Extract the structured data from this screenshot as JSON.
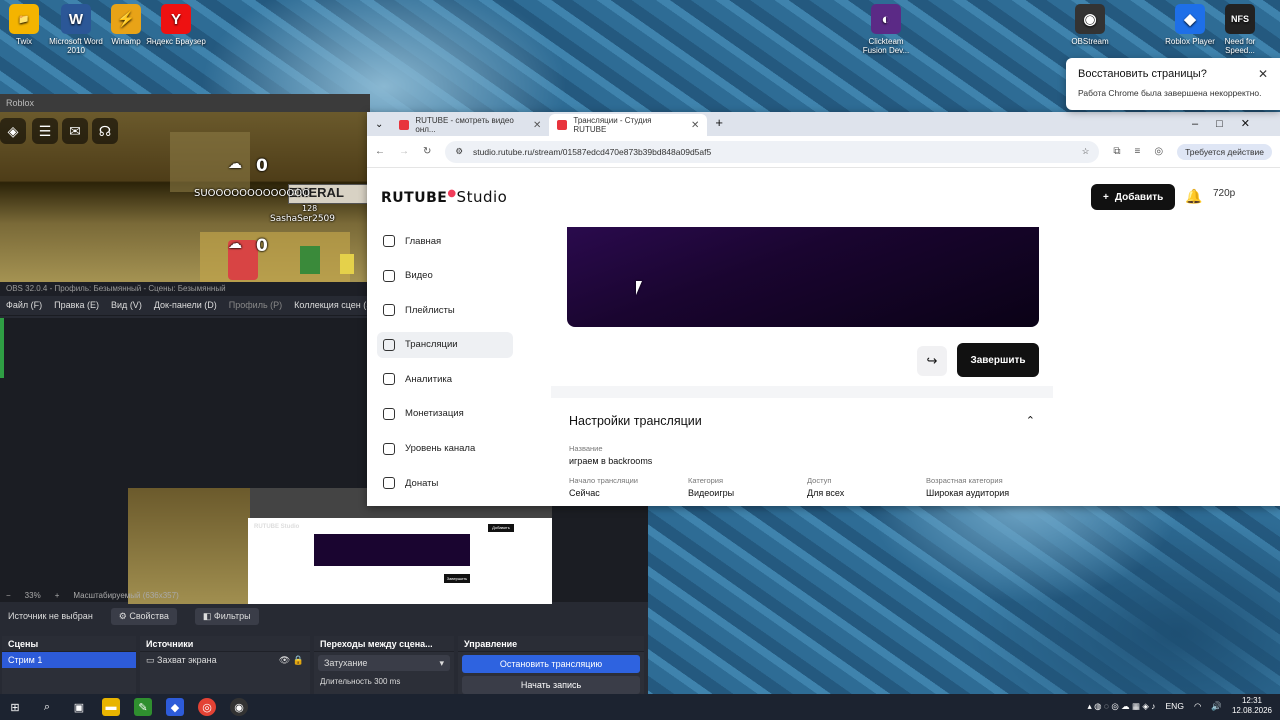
{
  "desktop": {
    "icons_left": [
      {
        "label": "Twix",
        "name": "twix-desktop-icon",
        "color": "#f4b400",
        "glyph": "📁"
      },
      {
        "label": "Microsoft Word 2010",
        "name": "word-desktop-icon",
        "color": "#2b5797",
        "glyph": "W"
      },
      {
        "label": "Winamp",
        "name": "winamp-desktop-icon",
        "color": "#e8a317",
        "glyph": "⚡"
      },
      {
        "label": "Яндекс Браузер",
        "name": "yandex-browser-desktop-icon",
        "color": "#e11",
        "glyph": "Y"
      }
    ],
    "icons_right": [
      {
        "label": "Clickteam Fusion Dev...",
        "name": "clickteam-desktop-icon",
        "color": "#5b2a86",
        "glyph": "◐"
      },
      {
        "label": "OBStream",
        "name": "obs-desktop-icon",
        "color": "#333",
        "glyph": "◉"
      },
      {
        "label": "Roblox Player",
        "name": "roblox-desktop-icon",
        "color": "#1e6fe8",
        "glyph": "◆"
      },
      {
        "label": "Need for Speed...",
        "name": "nfs-desktop-icon",
        "color": "#222",
        "glyph": "NFS"
      }
    ]
  },
  "game": {
    "title": "Roblox",
    "score_top": "0",
    "score_bottom": "0",
    "chat_line": "SUOOOOOOOOOOOOO",
    "player_name": "SashaSer2509",
    "player_level": "128",
    "sign_text": "EMERAL"
  },
  "obs": {
    "title": "OBS 32.0.4 - Профиль: Безымянный - Сцены: Безымянный",
    "menu": [
      "Файл (F)",
      "Правка (E)",
      "Вид (V)",
      "Док-панели (D)",
      "Профиль (P)",
      "Коллекция сцен (S)"
    ],
    "zoom": "33%",
    "scale_label": "Масштабируемый (636x357)",
    "no_source": "Источник не выбран",
    "properties": "Свойства",
    "filters": "Фильтры",
    "docks": {
      "scenes_title": "Сцены",
      "scene_item": "Стрим 1",
      "sources_title": "Источники",
      "source_item": "Захват экрана",
      "transitions_title": "Переходы между сцена...",
      "transition_value": "Затухание",
      "duration_label": "Длительность",
      "duration_value": "300 ms",
      "controls_title": "Управление",
      "stop_stream": "Остановить трансляцию",
      "start_record": "Начать запись"
    },
    "nested_canvas": {
      "logo": "RUTUBE Studio",
      "finish": "Завершить",
      "add": "Добавить"
    }
  },
  "chrome": {
    "tabs": [
      {
        "title": "RUTUBE - смотреть видео онл...",
        "active": false
      },
      {
        "title": "Трансляции - Студия RUTUBE",
        "active": true
      }
    ],
    "url": "studio.rutube.ru/stream/01587edcd470e873b39bd848a09d5af5",
    "action_required": "Требуется действие"
  },
  "rutube": {
    "logo_main": "RUTUBE",
    "logo_studio": "Studio",
    "add_button": "Добавить",
    "quality": "720p",
    "sidebar": [
      {
        "label": "Главная",
        "icon": "home-icon"
      },
      {
        "label": "Видео",
        "icon": "video-icon"
      },
      {
        "label": "Плейлисты",
        "icon": "playlist-icon"
      },
      {
        "label": "Трансляции",
        "icon": "broadcast-icon",
        "active": true
      },
      {
        "label": "Аналитика",
        "icon": "analytics-icon"
      },
      {
        "label": "Монетизация",
        "icon": "monetization-icon"
      },
      {
        "label": "Уровень канала",
        "icon": "channel-level-icon"
      },
      {
        "label": "Донаты",
        "icon": "donations-icon"
      }
    ],
    "finish_button": "Завершить",
    "settings": {
      "title": "Настройки трансляции",
      "name_label": "Название",
      "name_value": "играем в backrooms",
      "start_label": "Начало трансляции",
      "start_value": "Сейчас",
      "category_label": "Категория",
      "category_value": "Видеоигры",
      "access_label": "Доступ",
      "access_value": "Для всех",
      "age_label": "Возрастная категория",
      "age_value": "Широкая аудитория"
    }
  },
  "notification": {
    "title": "Восстановить страницы?",
    "body": "Работа Chrome была завершена некорректно."
  },
  "taskbar": {
    "language": "ENG",
    "time": "12:31",
    "date": "12.08.2026"
  },
  "colors": {
    "accent": "#2d5bd8",
    "rutube_red": "#f13d5b",
    "brand_dark": "#111111"
  }
}
